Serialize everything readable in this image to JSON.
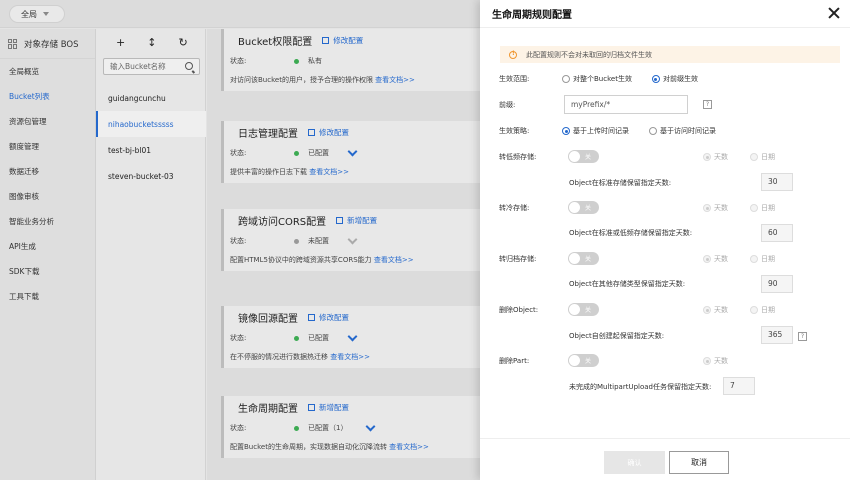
{
  "topbar": {
    "region_label": "全局"
  },
  "sidebar": {
    "brand": "对象存储 BOS",
    "items": [
      "全局概览",
      "Bucket列表",
      "资源包管理",
      "额度管理",
      "数据迁移",
      "图像审核",
      "智能业务分析",
      "API生成",
      "SDK下载",
      "工具下载"
    ],
    "active_index": 1
  },
  "buckets": {
    "search_placeholder": "输入Bucket名称",
    "tools": {
      "add": "+",
      "sort": "↕",
      "refresh": "↻"
    },
    "items": [
      "guidangcunchu",
      "nihaobucketsssss",
      "test-bj-bl01",
      "steven-bucket-03"
    ],
    "active_index": 1
  },
  "cards": [
    {
      "title": "Bucket权限配置",
      "action": "修改配置",
      "status_label": "状态:",
      "status": "私有",
      "status_color": "#3caa52",
      "desc": "对访问该Bucket的用户，授予合理的操作权限 ",
      "doc_link": "查看文档>>"
    },
    {
      "title": "日志管理配置",
      "action": "修改配置",
      "status_label": "状态:",
      "status": "已配置",
      "status_color": "#3caa52",
      "desc": "提供丰富的操作日志下载 ",
      "doc_link": "查看文档>>"
    },
    {
      "title": "跨域访问CORS配置",
      "action": "新增配置",
      "status_label": "状态:",
      "status": "未配置",
      "status_color": "#999999",
      "desc": "配置HTML5协议中的跨域资源共享CORS能力 ",
      "doc_link": "查看文档>>"
    },
    {
      "title": "镜像回源配置",
      "action": "修改配置",
      "status_label": "状态:",
      "status": "已配置",
      "status_color": "#3caa52",
      "desc": "在不停服的情况进行数据热迁移 ",
      "doc_link": "查看文档>>"
    },
    {
      "title": "生命周期配置",
      "action": "新增配置",
      "status_label": "状态:",
      "status": "已配置（1）",
      "status_color": "#3caa52",
      "desc": "配置Bucket的生命周期，实现数据自动化沉降流转 ",
      "doc_link": "查看文档>>"
    }
  ],
  "drawer": {
    "title": "生命周期规则配置",
    "notice": "此配置规则不会对未取回的归档文件生效",
    "scope": {
      "label": "生效范围:",
      "options": [
        "对整个Bucket生效",
        "对前缀生效"
      ],
      "selected": 1
    },
    "prefix": {
      "label": "前缀:",
      "value": "myPrefix/*",
      "help": "?"
    },
    "strategy": {
      "label": "生效策略:",
      "options": [
        "基于上传时间记录",
        "基于访问时间记录"
      ],
      "selected": 0
    },
    "rules": [
      {
        "label": "转低频存储:",
        "toggle": "关",
        "opt_days": "天数",
        "opt_date": "日期",
        "desc": "Object在标准存储保留指定天数:",
        "value": "30"
      },
      {
        "label": "转冷存储:",
        "toggle": "关",
        "opt_days": "天数",
        "opt_date": "日期",
        "desc": "Object在标准或低频存储保留指定天数:",
        "value": "60"
      },
      {
        "label": "转归档存储:",
        "toggle": "关",
        "opt_days": "天数",
        "opt_date": "日期",
        "desc": "Object在其他存储类型保留指定天数:",
        "value": "90"
      },
      {
        "label": "删除Object:",
        "toggle": "关",
        "opt_days": "天数",
        "opt_date": "日期",
        "desc": "Object自创建起保留指定天数:",
        "value": "365",
        "help": "?"
      },
      {
        "label": "删除Part:",
        "toggle": "关",
        "opt_days": "天数",
        "desc": "未完成的MultipartUpload任务保留指定天数:",
        "value": "7"
      }
    ],
    "ok_label": "确认",
    "cancel_label": "取消"
  }
}
